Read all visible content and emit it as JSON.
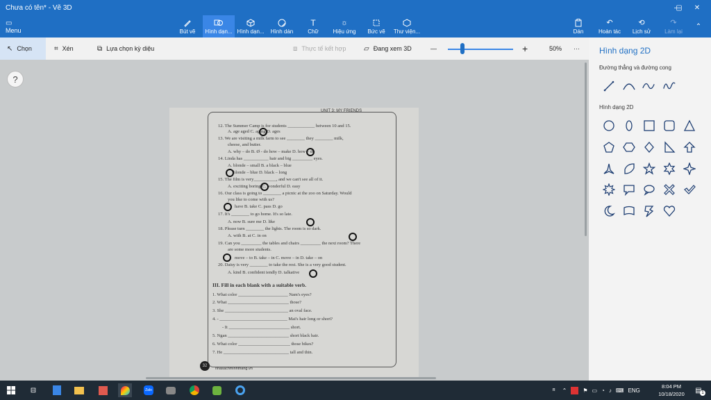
{
  "window": {
    "title": "Chưa có tên* - Vẽ 3D"
  },
  "ribbon": {
    "menu": "Menu",
    "tools": [
      {
        "label": "Bút vẽ",
        "icon": "brush-icon"
      },
      {
        "label": "Hình dạn...",
        "icon": "2d-shapes-icon",
        "active": true
      },
      {
        "label": "Hình dạn...",
        "icon": "3d-shapes-icon"
      },
      {
        "label": "Hình dán",
        "icon": "sticker-icon"
      },
      {
        "label": "Chữ",
        "icon": "text-icon"
      },
      {
        "label": "Hiệu ứng",
        "icon": "effects-icon"
      },
      {
        "label": "Bức vẽ",
        "icon": "canvas-icon"
      },
      {
        "label": "Thư viện...",
        "icon": "library-icon"
      }
    ],
    "right": [
      {
        "label": "Dán",
        "icon": "paste-icon"
      },
      {
        "label": "Hoàn tác",
        "icon": "undo-icon"
      },
      {
        "label": "Lịch sử",
        "icon": "history-icon"
      },
      {
        "label": "Làm lại",
        "icon": "redo-icon",
        "disabled": true
      }
    ]
  },
  "toolbar": {
    "select": "Chọn",
    "crop": "Xén",
    "magic_select": "Lựa chọn kỳ diệu",
    "mixed_reality": "Thực tế kết hợp",
    "view_3d": "Đang xem 3D",
    "zoom_minus": "—",
    "zoom_plus": "+",
    "zoom": "50%",
    "more": "···",
    "zoom_level": 0.2
  },
  "canvas": {
    "help": "?"
  },
  "worksheet": {
    "unit": "UNIT 3: MY FRIENDS",
    "lines": [
      "12.  The Summer Camp is for students ____________ between 10 and 15.",
      "A. age               aged                    C. aging                 D. ages",
      "13.  We are visiting a milk farm to see ________ they ________ milk,",
      "cheese, and butter.",
      "A. why – do      B. Ø - do              how – make       D. how – do",
      "14.  Linda has ___________ hair and big _________ eyes.",
      "A. blonde – small                             B. a black – blue",
      "blonde – blue                                D. black – long",
      "15.  The film is very__________, and we can't see all of it.",
      "A. exciting             boring                  C. wonderful            D. easy",
      "16.  Our class is going to ________ a picnic at the zoo on Saturday. Would",
      "you like to come with us?",
      "have              B. take                  C. pass                   D. go",
      "17.  It's ________ to go home. It's so late.",
      "A. now                B. sure                    me                       D. like",
      "18.  Please turn ________ the lights. The room is so dark.",
      "A. with                B. at                      C. in                        on",
      "19.  Can you _________ the tables and chairs _________ the next room? There",
      "are some more students.",
      "move – to        B. take – in            C. move – in          D. take – on",
      "20.  Daisy is very ________ to take the rest. She is a very good student.",
      "A. kind               B. confident              iendly                  D. talkative",
      "III.  Fill in each blank with a suitable verb.",
      "1.    What color ______________________ Nam's eyes?",
      "2.    What ___________________________ those?",
      "3.    She ____________________________ an oval face.",
      "4.    - ______________________________ Mai's hair long or short?",
      "- It ___________________________ short.",
      "5.    Ngan ___________________________ short black hair.",
      "6.    What color _______________________ those bikes?",
      "7.    He _____________________________ tall and thin."
    ],
    "page": "32",
    "site": "nhasachminhthang.vn"
  },
  "panel": {
    "title": "Hình dạng 2D",
    "section1": "Đường thẳng và đường cong",
    "section2": "Hình dạng 2D"
  },
  "taskbar": {
    "time": "8:04 PM",
    "date": "10/18/2020",
    "lang": "ENG",
    "notif": "1"
  }
}
